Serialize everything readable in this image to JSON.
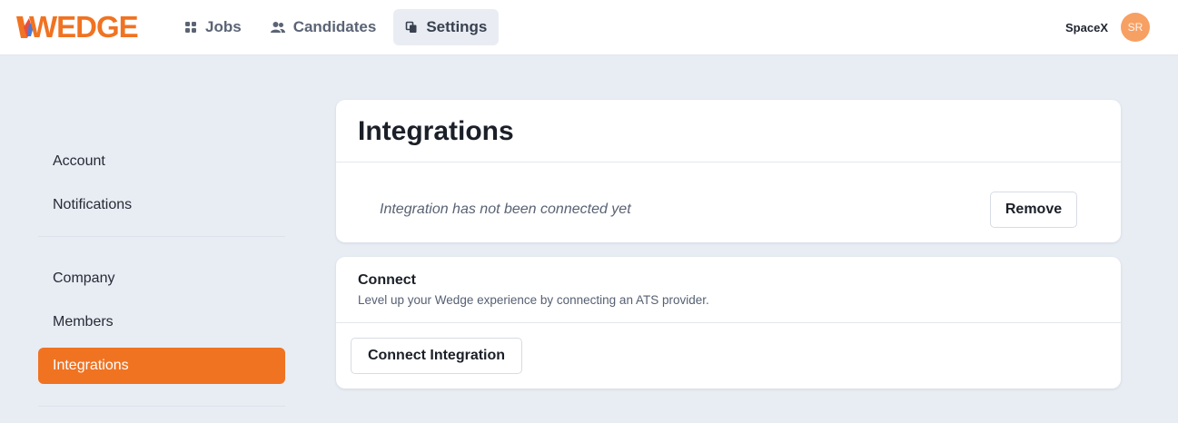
{
  "app": {
    "logo_text": "WEDGE",
    "brand_color": "#f07322"
  },
  "nav": {
    "items": [
      {
        "label": "Jobs",
        "icon": "grid-icon",
        "active": false
      },
      {
        "label": "Candidates",
        "icon": "users-icon",
        "active": false
      },
      {
        "label": "Settings",
        "icon": "copy-icon",
        "active": true
      }
    ]
  },
  "account": {
    "org_name": "SpaceX",
    "avatar_initials": "SR"
  },
  "sidebar": {
    "group1": [
      {
        "label": "Account"
      },
      {
        "label": "Notifications"
      }
    ],
    "group2": [
      {
        "label": "Company"
      },
      {
        "label": "Members"
      },
      {
        "label": "Integrations",
        "active": true
      }
    ]
  },
  "integrations": {
    "title": "Integrations",
    "status_text": "Integration has not been connected yet",
    "remove_label": "Remove"
  },
  "connect": {
    "title": "Connect",
    "description": "Level up your Wedge experience by connecting an ATS provider.",
    "button_label": "Connect Integration"
  }
}
